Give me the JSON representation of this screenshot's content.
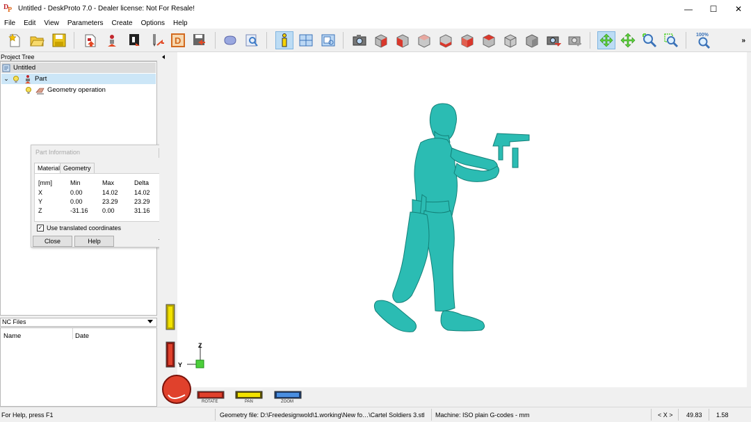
{
  "window": {
    "title": "Untitled - DeskProto 7.0 - Dealer license: Not For Resale!",
    "minimize": "—",
    "maximize": "☐",
    "close": "✕"
  },
  "menu": [
    "File",
    "Edit",
    "View",
    "Parameters",
    "Create",
    "Options",
    "Help"
  ],
  "toolbar": {
    "zoom_percent": "100%",
    "more": "»",
    "active_button": "part-info-button"
  },
  "project_tree": {
    "header": "Project Tree",
    "items": [
      {
        "label": "Untitled",
        "icon": "project-icon"
      },
      {
        "label": "Part",
        "icon": "part-icon",
        "expand": "⌄",
        "selected": true
      },
      {
        "label": "Geometry operation",
        "icon": "geometry-operation-icon"
      }
    ]
  },
  "nc_files": {
    "header": "NC Files",
    "columns": [
      "Name",
      "Date"
    ]
  },
  "part_info": {
    "title": "Part Information",
    "tabs": [
      "Material",
      "Geometry"
    ],
    "active_tab": "Material",
    "headers": [
      "[mm]",
      "Min",
      "Max",
      "Delta"
    ],
    "rows": [
      [
        "X",
        "0.00",
        "14.02",
        "14.02"
      ],
      [
        "Y",
        "0.00",
        "23.29",
        "23.29"
      ],
      [
        "Z",
        "-31.16",
        "0.00",
        "31.16"
      ]
    ],
    "checkbox_label": "Use translated coordinates",
    "checkbox_checked": true,
    "check_mark": "✓",
    "close_label": "Close",
    "help_label": "Help"
  },
  "viewport": {
    "model_color": "#2bbcb3",
    "axis_z": "Z",
    "axis_y": "Y",
    "controls": [
      "ROTATE",
      "PAN",
      "ZOOM"
    ]
  },
  "status": {
    "help": "For Help, press F1",
    "geometry_file": "Geometry file: D:\\Freedesignwold\\1.working\\New fo…\\Cartel Soldiers 3.stl",
    "machine": "Machine: ISO plain G-codes - mm",
    "axis_nav": "< X >",
    "coord1": "49.83",
    "coord2": "1.58"
  }
}
